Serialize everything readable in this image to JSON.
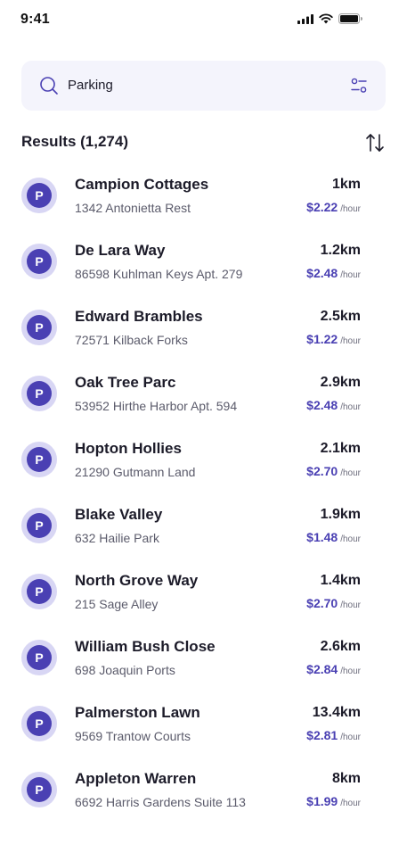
{
  "status_bar": {
    "time": "9:41"
  },
  "search": {
    "value": "Parking"
  },
  "results": {
    "title": "Results (1,274)"
  },
  "colors": {
    "accent": "#4a40b3",
    "badge_ring": "#d8d6f4",
    "search_bg": "#f4f4fc"
  },
  "parking_list": [
    {
      "icon": "P",
      "name": "Campion Cottages",
      "address": "1342 Antonietta Rest",
      "distance": "1km",
      "price": "$2.22",
      "unit": "/hour"
    },
    {
      "icon": "P",
      "name": "De Lara Way",
      "address": "86598 Kuhlman Keys Apt. 279",
      "distance": "1.2km",
      "price": "$2.48",
      "unit": "/hour"
    },
    {
      "icon": "P",
      "name": "Edward Brambles",
      "address": "72571 Kilback Forks",
      "distance": "2.5km",
      "price": "$1.22",
      "unit": "/hour"
    },
    {
      "icon": "P",
      "name": "Oak Tree Parc",
      "address": "53952 Hirthe Harbor Apt. 594",
      "distance": "2.9km",
      "price": "$2.48",
      "unit": "/hour"
    },
    {
      "icon": "P",
      "name": "Hopton Hollies",
      "address": "21290 Gutmann Land",
      "distance": "2.1km",
      "price": "$2.70",
      "unit": "/hour"
    },
    {
      "icon": "P",
      "name": "Blake Valley",
      "address": "632 Hailie Park",
      "distance": "1.9km",
      "price": "$1.48",
      "unit": "/hour"
    },
    {
      "icon": "P",
      "name": "North Grove Way",
      "address": "215 Sage Alley",
      "distance": "1.4km",
      "price": "$2.70",
      "unit": "/hour"
    },
    {
      "icon": "P",
      "name": "William Bush Close",
      "address": "698 Joaquin Ports",
      "distance": "2.6km",
      "price": "$2.84",
      "unit": "/hour"
    },
    {
      "icon": "P",
      "name": "Palmerston Lawn",
      "address": "9569 Trantow Courts",
      "distance": "13.4km",
      "price": "$2.81",
      "unit": "/hour"
    },
    {
      "icon": "P",
      "name": "Appleton Warren",
      "address": "6692 Harris Gardens Suite 113",
      "distance": "8km",
      "price": "$1.99",
      "unit": "/hour"
    }
  ]
}
